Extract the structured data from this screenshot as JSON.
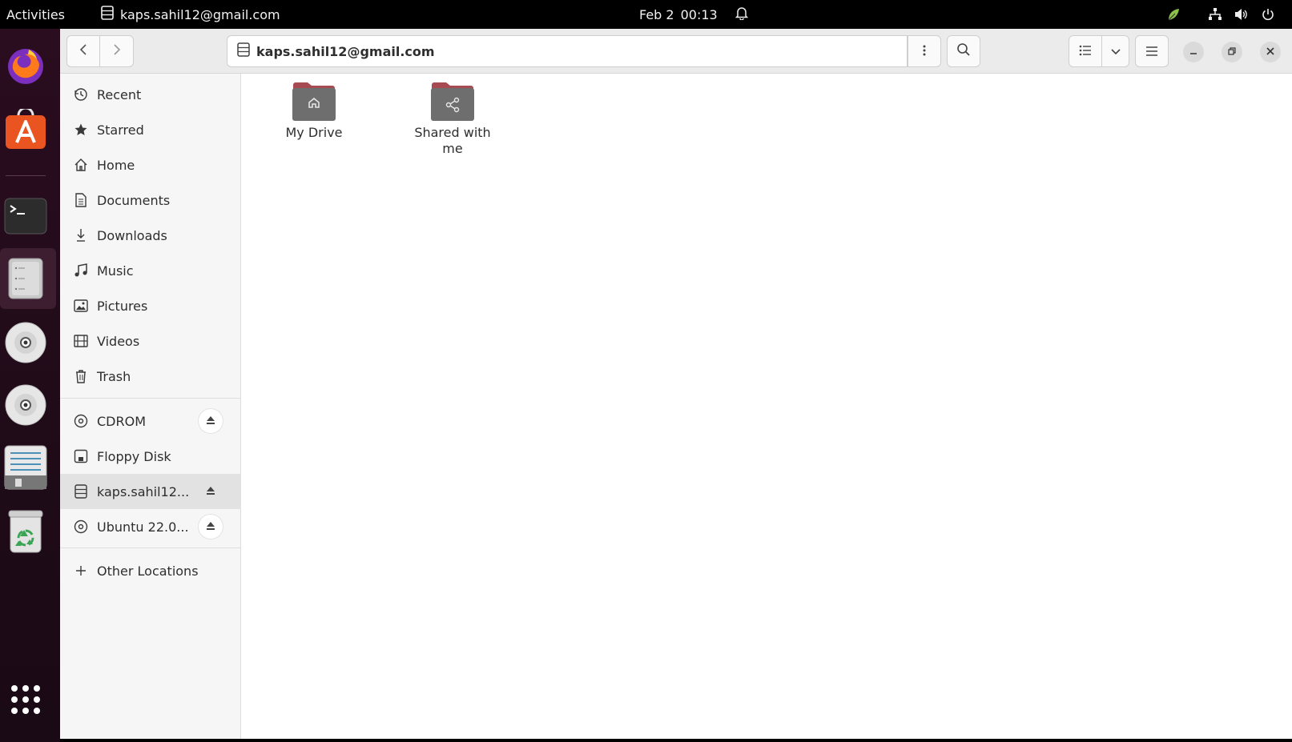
{
  "topbar": {
    "activities": "Activities",
    "app_title": "kaps.sahil12@gmail.com",
    "date": "Feb 2",
    "time": "00:13"
  },
  "dock": {
    "items": [
      "firefox-icon",
      "app-store-icon",
      "terminal-icon",
      "files-icon",
      "cd-icon",
      "cd-icon",
      "text-editor-icon",
      "trash-icon",
      "show-apps-icon"
    ]
  },
  "headerbar": {
    "path": "kaps.sahil12@gmail.com"
  },
  "sidebar": {
    "items": [
      {
        "label": "Recent",
        "icon": "clock-icon"
      },
      {
        "label": "Starred",
        "icon": "star-icon"
      },
      {
        "label": "Home",
        "icon": "home-icon"
      },
      {
        "label": "Documents",
        "icon": "document-icon"
      },
      {
        "label": "Downloads",
        "icon": "download-icon"
      },
      {
        "label": "Music",
        "icon": "music-icon"
      },
      {
        "label": "Pictures",
        "icon": "picture-icon"
      },
      {
        "label": "Videos",
        "icon": "video-icon"
      },
      {
        "label": "Trash",
        "icon": "trash-icon"
      }
    ],
    "devices": [
      {
        "label": "CDROM",
        "icon": "disc-icon",
        "eject": true
      },
      {
        "label": "Floppy Disk",
        "icon": "floppy-icon",
        "eject": false
      },
      {
        "label": "kaps.sahil12...",
        "icon": "network-drive-icon",
        "eject": true,
        "active": true
      },
      {
        "label": "Ubuntu 22.0...",
        "icon": "disc-icon",
        "eject": true
      }
    ],
    "other_locations": "Other Locations"
  },
  "content": {
    "items": [
      {
        "label": "My Drive",
        "icon": "home-folder-icon"
      },
      {
        "label": "Shared with me",
        "icon": "shared-folder-icon"
      }
    ]
  },
  "colors": {
    "folder": "#a84a52",
    "folder_front": "#6e6e6e",
    "dock_bg": "#2a0d1f",
    "accent": "#e95420"
  }
}
